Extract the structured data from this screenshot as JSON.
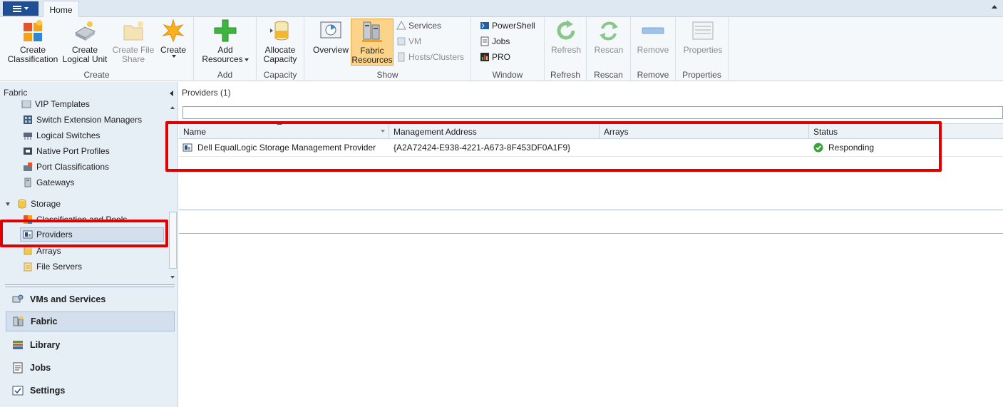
{
  "ribbon": {
    "tabs": [
      {
        "label": "Home"
      }
    ],
    "groups": {
      "create": {
        "label": "Create",
        "buttons": [
          {
            "label_line1": "Create",
            "label_line2": "Classification",
            "icon": "classification-icon"
          },
          {
            "label_line1": "Create",
            "label_line2": "Logical Unit",
            "icon": "logical-unit-icon"
          },
          {
            "label_line1": "Create File",
            "label_line2": "Share",
            "icon": "file-share-icon"
          },
          {
            "label_line1": "Create",
            "label_line2": "",
            "icon": "starburst-icon"
          }
        ]
      },
      "add": {
        "label": "Add",
        "button_line1": "Add",
        "button_line2": "Resources",
        "icon": "green-plus-icon"
      },
      "capacity": {
        "label": "Capacity",
        "button_line1": "Allocate",
        "button_line2": "Capacity",
        "icon": "database-icon"
      },
      "show": {
        "label": "Show",
        "overview": "Overview",
        "fabric_line1": "Fabric",
        "fabric_line2": "Resources",
        "small": [
          "Services",
          "VM",
          "Hosts/Clusters"
        ]
      },
      "window": {
        "label": "Window",
        "small": [
          "PowerShell",
          "Jobs",
          "PRO"
        ]
      },
      "refresh": {
        "label": "Refresh",
        "button": "Refresh"
      },
      "rescan": {
        "label": "Rescan",
        "button": "Rescan"
      },
      "remove": {
        "label": "Remove",
        "button": "Remove"
      },
      "properties": {
        "label": "Properties",
        "button": "Properties"
      }
    }
  },
  "sidebar": {
    "header": "Fabric",
    "tree": [
      {
        "label": "VIP Templates",
        "icon": "vip-template-icon"
      },
      {
        "label": "Switch Extension Managers",
        "icon": "switch-extension-icon"
      },
      {
        "label": "Logical Switches",
        "icon": "logical-switch-icon"
      },
      {
        "label": "Native Port Profiles",
        "icon": "port-profile-icon"
      },
      {
        "label": "Port Classifications",
        "icon": "port-classification-icon"
      },
      {
        "label": "Gateways",
        "icon": "gateway-icon"
      },
      {
        "label": "Storage",
        "icon": "storage-icon"
      },
      {
        "label": "Classification and Pools",
        "icon": "classification-pools-icon"
      },
      {
        "label": "Providers",
        "icon": "provider-icon"
      },
      {
        "label": "Arrays",
        "icon": "arrays-icon"
      },
      {
        "label": "File Servers",
        "icon": "file-servers-icon"
      }
    ],
    "workspaces": [
      {
        "label": "VMs and Services",
        "icon": "vms-services-icon"
      },
      {
        "label": "Fabric",
        "icon": "fabric-icon"
      },
      {
        "label": "Library",
        "icon": "library-icon"
      },
      {
        "label": "Jobs",
        "icon": "jobs-icon"
      },
      {
        "label": "Settings",
        "icon": "settings-icon"
      }
    ]
  },
  "main": {
    "title": "Providers (1)",
    "columns": [
      "Name",
      "Management Address",
      "Arrays",
      "Status"
    ],
    "rows": [
      {
        "name": "Dell EqualLogic Storage Management Provider",
        "address": "{A2A72424-E938-4221-A673-8F453DF0A1F9}",
        "arrays": "",
        "status": "Responding"
      }
    ]
  },
  "colors": {
    "highlight": "#e00000",
    "ribbon_bg": "#f5f8fb",
    "pane_bg": "#e6eef6",
    "active_button": "#fbd48a",
    "status_ok": "#3aa339"
  }
}
